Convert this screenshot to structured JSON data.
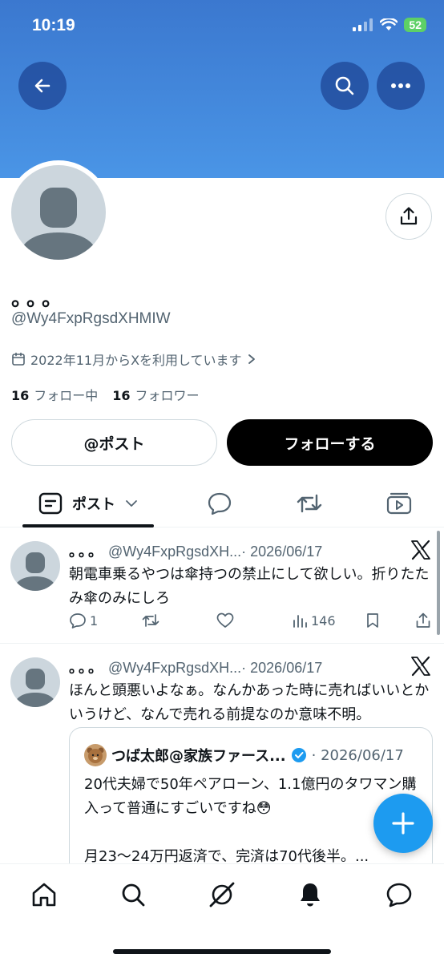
{
  "status_bar": {
    "time": "10:19",
    "battery": "52"
  },
  "profile": {
    "display_name": "。。。",
    "handle": "@Wy4FxpRgsdXHMIW",
    "joined": "2022年11月からXを利用しています",
    "following_count": "16",
    "following_label": "フォロー中",
    "followers_count": "16",
    "followers_label": "フォロワー"
  },
  "buttons": {
    "mention": "@ポスト",
    "follow": "フォローする"
  },
  "tabs": {
    "posts_label": "ポスト"
  },
  "posts": [
    {
      "name": "。。。",
      "handle": "@Wy4FxpRgsdXH...",
      "date": "· 2026/06/17",
      "text": "朝電車乗るやつは傘持つの禁止にして欲しい。折りたたみ傘のみにしろ",
      "replies": "1",
      "views": "146"
    },
    {
      "name": "。。。",
      "handle": "@Wy4FxpRgsdXH...",
      "date": "· 2026/06/17",
      "text": "ほんと頭悪いよなぁ。なんかあった時に売ればいいとかいうけど、なんで売れる前提なのか意味不明。",
      "quote": {
        "name": "つば太郎@家族ファース...",
        "date": "· 2026/06/17",
        "text": "20代夫婦で50年ペアローン、1.1億円のタワマン購入って普通にすごいですね😳\n\n月23〜24万円返済で、完済は70代後半。..."
      }
    }
  ],
  "colors": {
    "banner": "#4a95e6",
    "accent": "#1d9bf0",
    "text_secondary": "#536471"
  }
}
